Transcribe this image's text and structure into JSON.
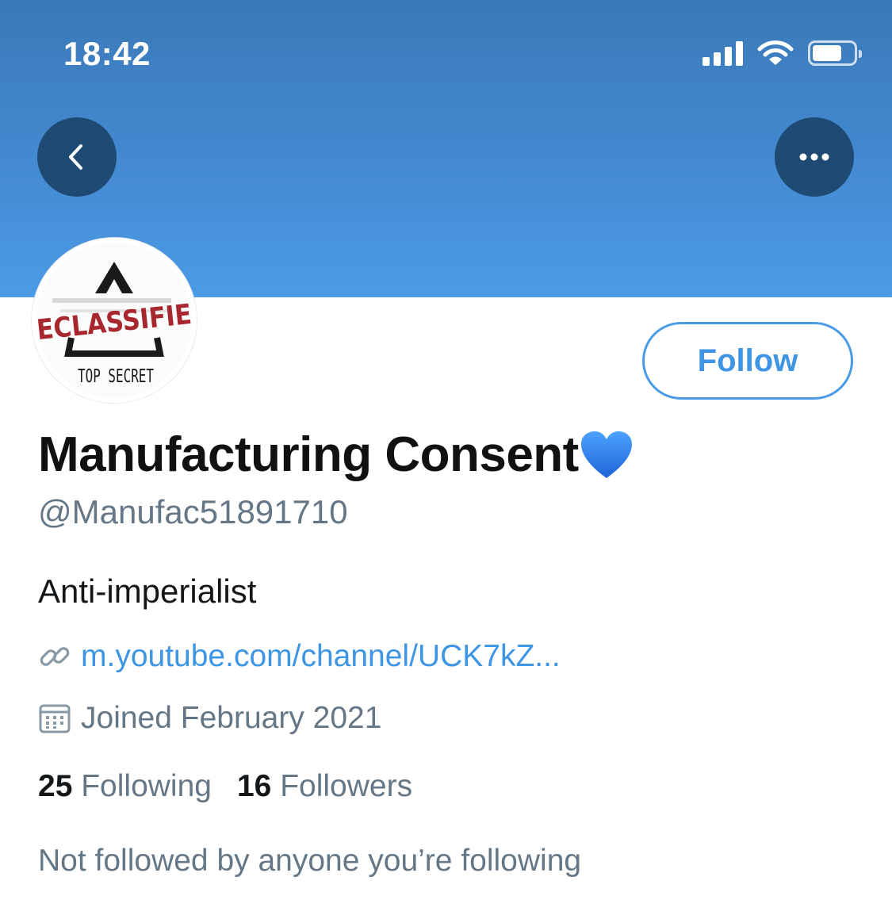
{
  "status_bar": {
    "time": "18:42"
  },
  "profile": {
    "avatar_text": {
      "top": "ECLASSIFIE",
      "bottom": "TOP SECRET"
    },
    "follow_label": "Follow",
    "display_name": "Manufacturing Consent",
    "display_name_emoji": "💙",
    "handle": "@Manufac51891710",
    "bio": "Anti-imperialist",
    "link": "m.youtube.com/channel/UCK7kZ...",
    "joined": "Joined February 2021",
    "following_count": "25",
    "following_label": "Following",
    "followers_count": "16",
    "followers_label": "Followers",
    "mutual_note": "Not followed by anyone you’re following"
  },
  "colors": {
    "banner_top": "#3a79b8",
    "banner_bottom": "#4b9be6",
    "accent": "#3d95e3",
    "secondary_text": "#657786",
    "nav_button": "#1e4a73"
  },
  "icons": [
    "back-chevron-icon",
    "more-dots-icon",
    "signal-icon",
    "wifi-icon",
    "battery-icon",
    "link-icon",
    "calendar-icon",
    "blue-heart-icon"
  ]
}
